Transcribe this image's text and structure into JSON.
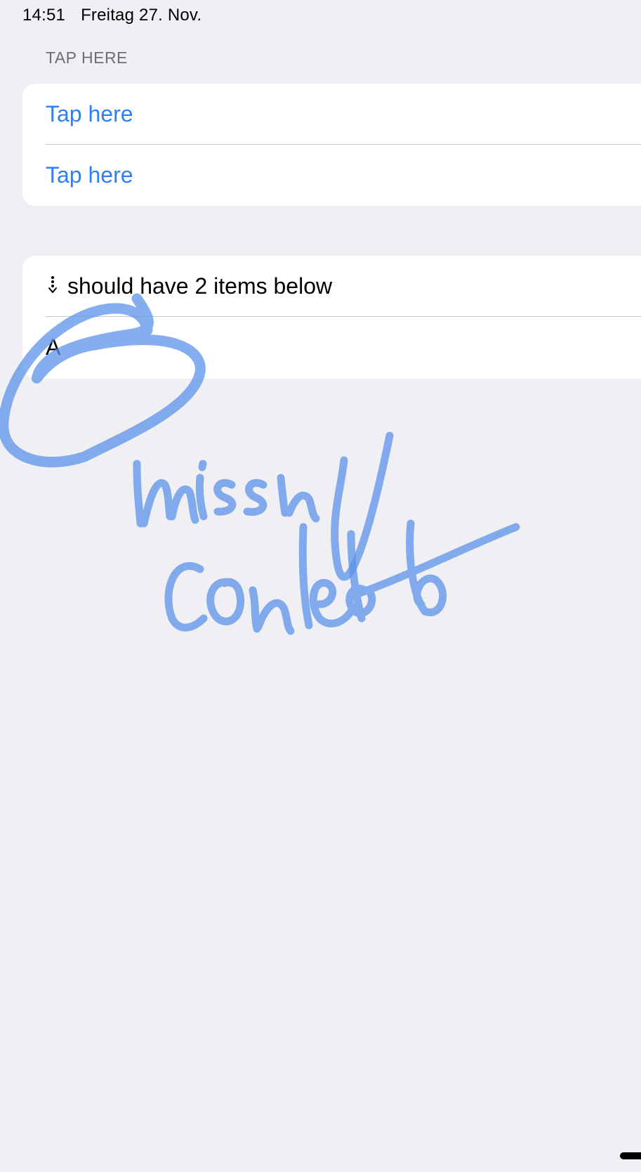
{
  "status_bar": {
    "time": "14:51",
    "date": "Freitag 27. Nov."
  },
  "section_1": {
    "header": "TAP HERE",
    "rows": [
      {
        "label": "Tap here"
      },
      {
        "label": "Tap here"
      }
    ]
  },
  "section_2": {
    "rows": [
      {
        "icon": "arrow-down-dotted-icon",
        "label": "should have 2 items below"
      },
      {
        "label": "A"
      }
    ]
  },
  "annotation": {
    "handwritten_text": "missing content",
    "color": "#5b93ea"
  },
  "colors": {
    "accent": "#2f7ff0",
    "background": "#efeff4",
    "separator": "#c8c7cc"
  }
}
